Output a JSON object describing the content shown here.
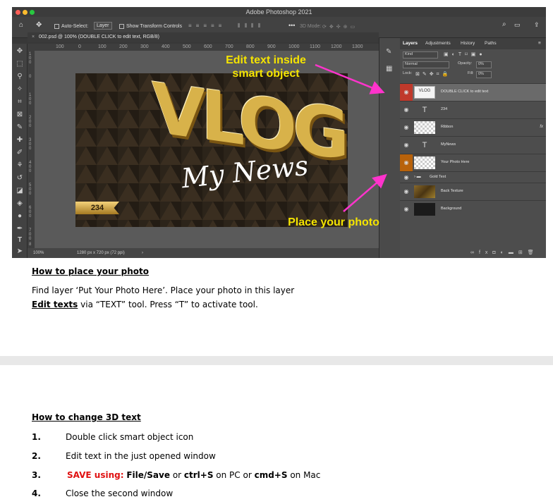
{
  "app": {
    "title": "Adobe Photoshop 2021",
    "options": {
      "auto_select_label": "Auto-Select:",
      "auto_select_value": "Layer",
      "transform_label": "Show Transform Controls",
      "mode_3d": "3D Mode:"
    },
    "document_tab": "002.psd @ 100% (DOUBLE CLICK to edit text, RGB/8)",
    "ruler_marks": [
      "100",
      "0",
      "100",
      "200",
      "300",
      "400",
      "500",
      "600",
      "700",
      "800",
      "900",
      "1000",
      "1100",
      "1200",
      "1300"
    ],
    "vruler_marks": [
      "1 0 0",
      "0",
      "1 0 0",
      "2 0 0",
      "3 0 0",
      "4 0 0",
      "5 0 0",
      "6 0 0",
      "7 0 0",
      "8"
    ],
    "status": {
      "zoom": "100%",
      "size": "1280 px x 720 px (72 ppi)"
    },
    "canvas": {
      "title": "VLOG",
      "script": "My News",
      "ribbon": "234"
    },
    "callouts": {
      "edit_text": "Edit text inside smart object",
      "place_photo": "Place your photo"
    },
    "layers_panel": {
      "tabs": [
        "Layers",
        "Adjustments",
        "History",
        "Paths"
      ],
      "kind": "Kind",
      "blend": "Normal",
      "opacity_label": "Opacity:",
      "opacity": "0%",
      "lock_label": "Lock:",
      "fill_label": "Fill:",
      "fill": "0%",
      "layers": [
        {
          "name": "DOUBLE CLICK to edit text",
          "type": "smart",
          "thumb_text": "VLOG",
          "eye_color": "#c0392b"
        },
        {
          "name": "234",
          "type": "text"
        },
        {
          "name": "Ribbon",
          "type": "checker",
          "fx": "fx"
        },
        {
          "name": "MyNews",
          "type": "text"
        },
        {
          "name": "Your Photo Here",
          "type": "checker",
          "eye_color": "#b8620b"
        },
        {
          "name": "Gold Text",
          "type": "group"
        },
        {
          "name": "Back Texture",
          "type": "texture"
        },
        {
          "name": "Background",
          "type": "dark"
        }
      ]
    }
  },
  "instructions": {
    "section1": {
      "heading": "How to place your photo",
      "line1": "Find layer ‘Put Your Photo Here’. Place your photo in this layer",
      "line2_link": "Edit texts",
      "line2_rest": " via “TEXT” tool. Press “T” to activate tool."
    },
    "section2": {
      "heading": "How to change 3D text",
      "steps": [
        {
          "num": "1.",
          "text": "Double click smart object icon"
        },
        {
          "num": "2.",
          "text": "Edit text in the just opened window"
        },
        {
          "num": "3.",
          "save": "SAVE using:",
          "a": "File/Save",
          "or1": " or ",
          "b": "ctrl+S",
          "on1": " on PC or ",
          "c": "cmd+S",
          "on2": " on Mac"
        },
        {
          "num": "4.",
          "text": "Close the second window"
        }
      ]
    }
  },
  "colors": {
    "callout": "#f5e400",
    "arrow": "#ff33cc",
    "gold": "#d8b24a"
  }
}
